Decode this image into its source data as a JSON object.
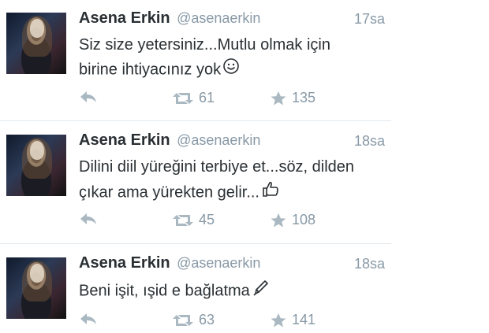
{
  "tweets": [
    {
      "name": "Asena Erkin",
      "handle": "@asenaerkin",
      "time": "17sa",
      "line1": "Siz size yetersiniz...Mutlu olmak için",
      "line2": "birine ihtiyacınız yok",
      "trailing_icon": "smiley-icon",
      "retweets": "61",
      "favorites": "135"
    },
    {
      "name": "Asena Erkin",
      "handle": "@asenaerkin",
      "time": "18sa",
      "line1": "Dilini diil yüreğini terbiye et...söz, dilden",
      "line2": "çıkar ama yürekten gelir...",
      "trailing_icon": "thumbs-up-icon",
      "retweets": "45",
      "favorites": "108"
    },
    {
      "name": "Asena Erkin",
      "handle": "@asenaerkin",
      "time": "18sa",
      "line1": "Beni işit, ışid e bağlatma",
      "line2": "",
      "trailing_icon": "pen-icon",
      "retweets": "63",
      "favorites": "141"
    }
  ],
  "colors": {
    "text": "#292f33",
    "muted": "#8899a6",
    "divider": "#e1e8ed"
  }
}
